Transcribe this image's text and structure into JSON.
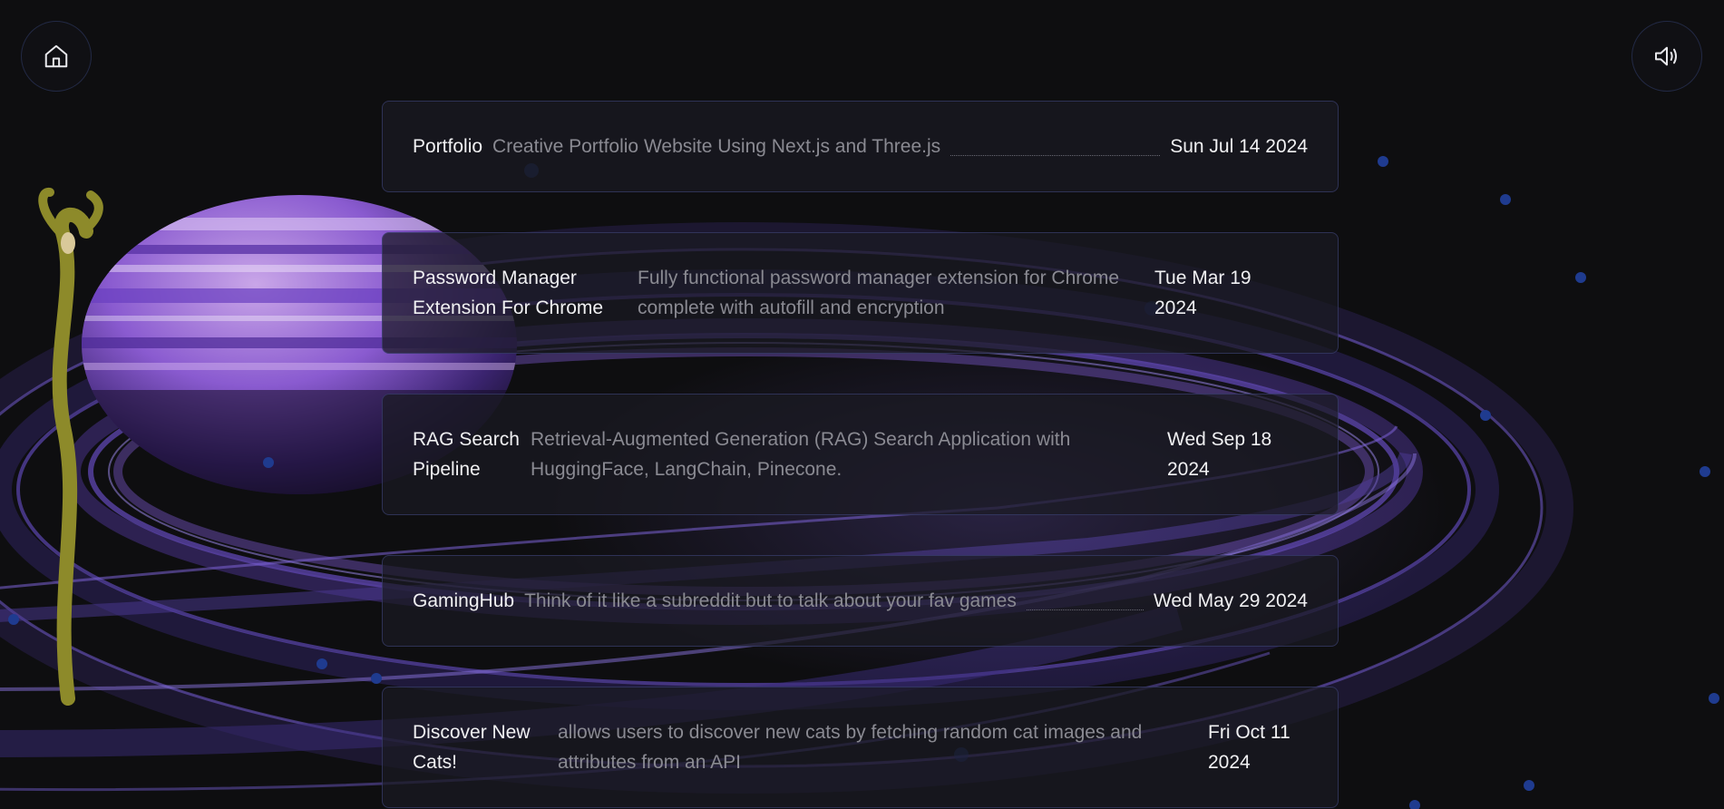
{
  "nav": {
    "home_icon": "home-icon",
    "sound_icon": "speaker-on-icon"
  },
  "projects": [
    {
      "title": "Portfolio",
      "description": "Creative Portfolio Website Using Next.js and Three.js",
      "date": "Sun Jul 14 2024"
    },
    {
      "title": "Password Manager Extension For Chrome",
      "description": "Fully functional password manager extension for Chrome complete with autofill and encryption",
      "date": "Tue Mar 19 2024"
    },
    {
      "title": "RAG Search Pipeline",
      "description": "Retrieval-Augmented Generation (RAG) Search Application with HuggingFace, LangChain, Pinecone.",
      "date": "Wed Sep 18 2024"
    },
    {
      "title": "GamingHub",
      "description": "Think of it like a subreddit but to talk about your fav games",
      "date": "Wed May 29 2024"
    },
    {
      "title": "Discover New Cats!",
      "description": "allows users to discover new cats by fetching random cat images and attributes from an API",
      "date": "Fri Oct 11 2024"
    }
  ],
  "colors": {
    "background": "#0e0e10",
    "planet_purple": "#7b52c8",
    "ring_purple": "#6a4bb0",
    "card_border": "#3f4a8c",
    "star_blue": "#1e3a8a"
  }
}
